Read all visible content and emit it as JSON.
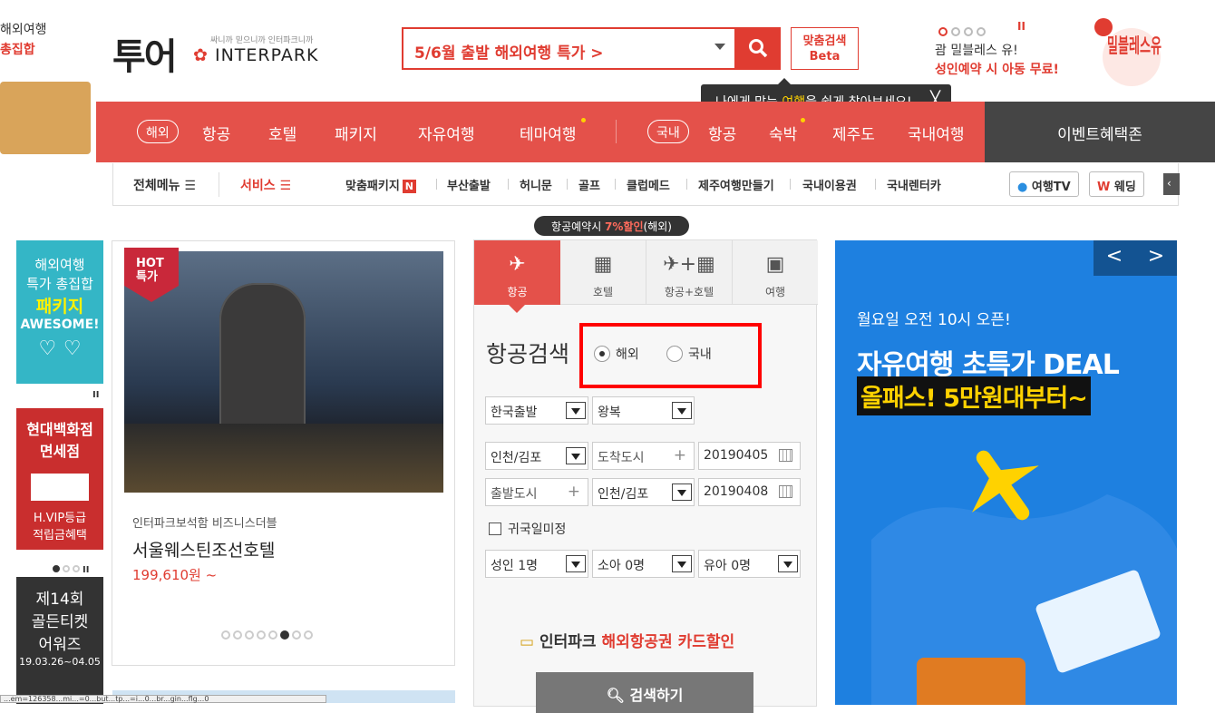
{
  "promo_left": {
    "line1": "해외여행",
    "line2": "총집합"
  },
  "logo": {
    "tour": "투어",
    "tagline": "싸니까 믿으니까 인터파크니까",
    "brand": "INTERPARK"
  },
  "search": {
    "value": "5/6월 출발 해외여행 특가 >",
    "custom_label_1": "맞춤검색",
    "custom_label_2": "Beta"
  },
  "tooltip": {
    "pre": "나에게 맞는 ",
    "highlight": "여행",
    "post": "을 쉽게 찾아보세요!",
    "close": "╳"
  },
  "top_ad": {
    "line1": "괌 밀블레스 유!",
    "line2": "성인예약 시 아동 무료!",
    "logo_text": "밀블레스유",
    "pause": "II"
  },
  "nav": {
    "overseas_pill": "해외",
    "overseas": [
      "항공",
      "호텔",
      "패키지",
      "자유여행",
      "테마여행"
    ],
    "domestic_pill": "국내",
    "domestic": [
      "항공",
      "숙박",
      "제주도",
      "국내여행"
    ],
    "event": "이벤트혜택존"
  },
  "subnav": {
    "all_menu": "전체메뉴 ☰",
    "service": "서비스 ☰",
    "items": [
      "맞춤패키지",
      "부산출발",
      "허니문",
      "골프",
      "클럽메드",
      "제주여행만들기",
      "국내이용권",
      "국내렌터카"
    ],
    "badge": "N",
    "tv": "여행TV",
    "wedding": "웨딩"
  },
  "left_banners": {
    "b1": [
      "해외여행",
      "특가 총집합",
      "패키지",
      "AWESOME!"
    ],
    "b2": [
      "현대백화점",
      "면세점",
      "H.VIP등급",
      "적립금혜택"
    ],
    "b3": [
      "제14회",
      "골든티켓",
      "어워즈",
      "19.03.26~04.05"
    ],
    "pause": "II"
  },
  "hotel": {
    "badge1": "HOT",
    "badge2": "특가",
    "sub": "인터파크보석함 비즈니스더블",
    "name": "서울웨스틴조선호텔",
    "price": "199,610원 ~"
  },
  "flight": {
    "discount_pre": "항공예약시 ",
    "discount_hl": "7%할인",
    "discount_post": "(해외)",
    "tabs": [
      "항공",
      "호텔",
      "항공+호텔",
      "여행"
    ],
    "tab_icons": [
      "✈",
      "▦",
      "✈+▦",
      "▣"
    ],
    "title": "항공검색",
    "radio": [
      "해외",
      "국내"
    ],
    "selected_radio": "해외",
    "row1": [
      "한국출발",
      "왕복"
    ],
    "row2": [
      "인천/김포",
      "도착도시",
      "20190405"
    ],
    "row3": [
      "출발도시",
      "인천/김포",
      "20190408"
    ],
    "undecided": "귀국일미정",
    "row4": [
      "성인 1명",
      "소아 0명",
      "유아 0명"
    ],
    "card_pre": "인터파크 ",
    "card_hl": "해외항공권 카드할인",
    "search_btn": "검색하기"
  },
  "right_banner": {
    "open": "월요일 오전 10시 오픈!",
    "h1": "자유여행 초특가 DEAL",
    "h2": "올패스! 5만원대부터~",
    "prev": "<",
    "next": ">"
  },
  "status_bar": "...em=126358...mi...=0...but...tp...=i...0...br...gin...flg...0",
  "colors": {
    "brand_red": "#e4514a",
    "accent_red": "#e03c31",
    "banner_blue": "#1e80e0"
  }
}
